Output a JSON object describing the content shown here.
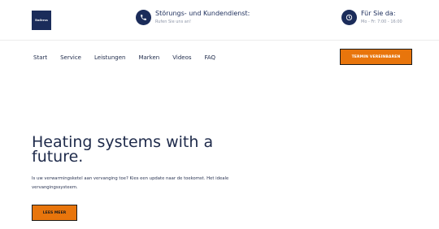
{
  "brand": {
    "logo_text": "Buderus"
  },
  "header": {
    "hotline": {
      "icon": "phone-icon",
      "title": "Störungs- und Kundendienst:",
      "subtitle": "Rufen Sie uns an!"
    },
    "hours": {
      "icon": "clock-icon",
      "title": "Für Sie da:",
      "subtitle": "Mo - Fr: 7:00 - 16:00"
    }
  },
  "nav": {
    "items": [
      {
        "label": "Start"
      },
      {
        "label": "Service"
      },
      {
        "label": "Leistungen"
      },
      {
        "label": "Marken"
      },
      {
        "label": "Videos"
      },
      {
        "label": "FAQ"
      }
    ],
    "cta_label": "TERMIN VEREINBAREN"
  },
  "hero": {
    "title": "Heating systems with a future.",
    "text": "Is uw verwarmingsketel aan vervanging toe? Kies een update naar de toekomst. Het ideale vervangingssysteem.",
    "cta_label": "LEES MEER"
  },
  "colors": {
    "brand_navy": "#1b2c5a",
    "accent_orange": "#e8750c"
  }
}
